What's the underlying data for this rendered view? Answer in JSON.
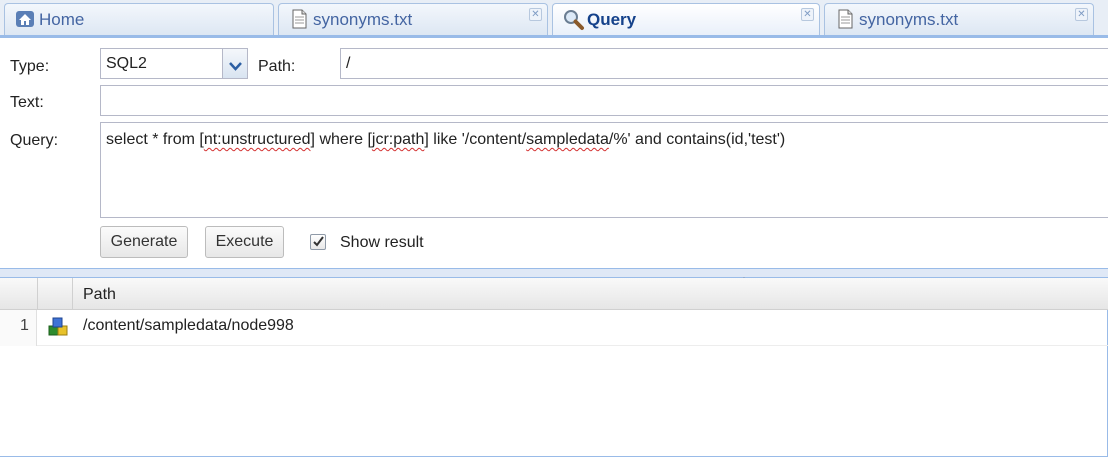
{
  "tabs": [
    {
      "label": "Home",
      "icon": "home-icon",
      "active": false,
      "closable": false
    },
    {
      "label": "synonyms.txt",
      "icon": "document-icon",
      "active": false,
      "closable": true
    },
    {
      "label": "Query",
      "icon": "magnifier-icon",
      "active": true,
      "closable": true
    },
    {
      "label": "synonyms.txt",
      "icon": "document-icon",
      "active": false,
      "closable": true
    }
  ],
  "form": {
    "type_label": "Type:",
    "type_value": "SQL2",
    "path_label": "Path:",
    "path_value": "/",
    "text_label": "Text:",
    "text_value": "",
    "query_label": "Query:",
    "query_parts": {
      "p1": "select * from [",
      "p2": "nt:unstructured",
      "p3": "] where [",
      "p4": "jcr:path",
      "p5": "] like '/content/",
      "p6": "sampledata",
      "p7": "/%' and contains(id,'test')"
    }
  },
  "buttons": {
    "generate": "Generate",
    "execute": "Execute"
  },
  "show_result": {
    "label": "Show result",
    "checked": true
  },
  "grid": {
    "columns": [
      "",
      "",
      "Path"
    ],
    "rows": [
      {
        "num": "1",
        "icon": "node-icon",
        "path": "/content/sampledata/node998"
      }
    ]
  },
  "colors": {
    "accent": "#99bbe8",
    "tab_text": "#15428b"
  }
}
